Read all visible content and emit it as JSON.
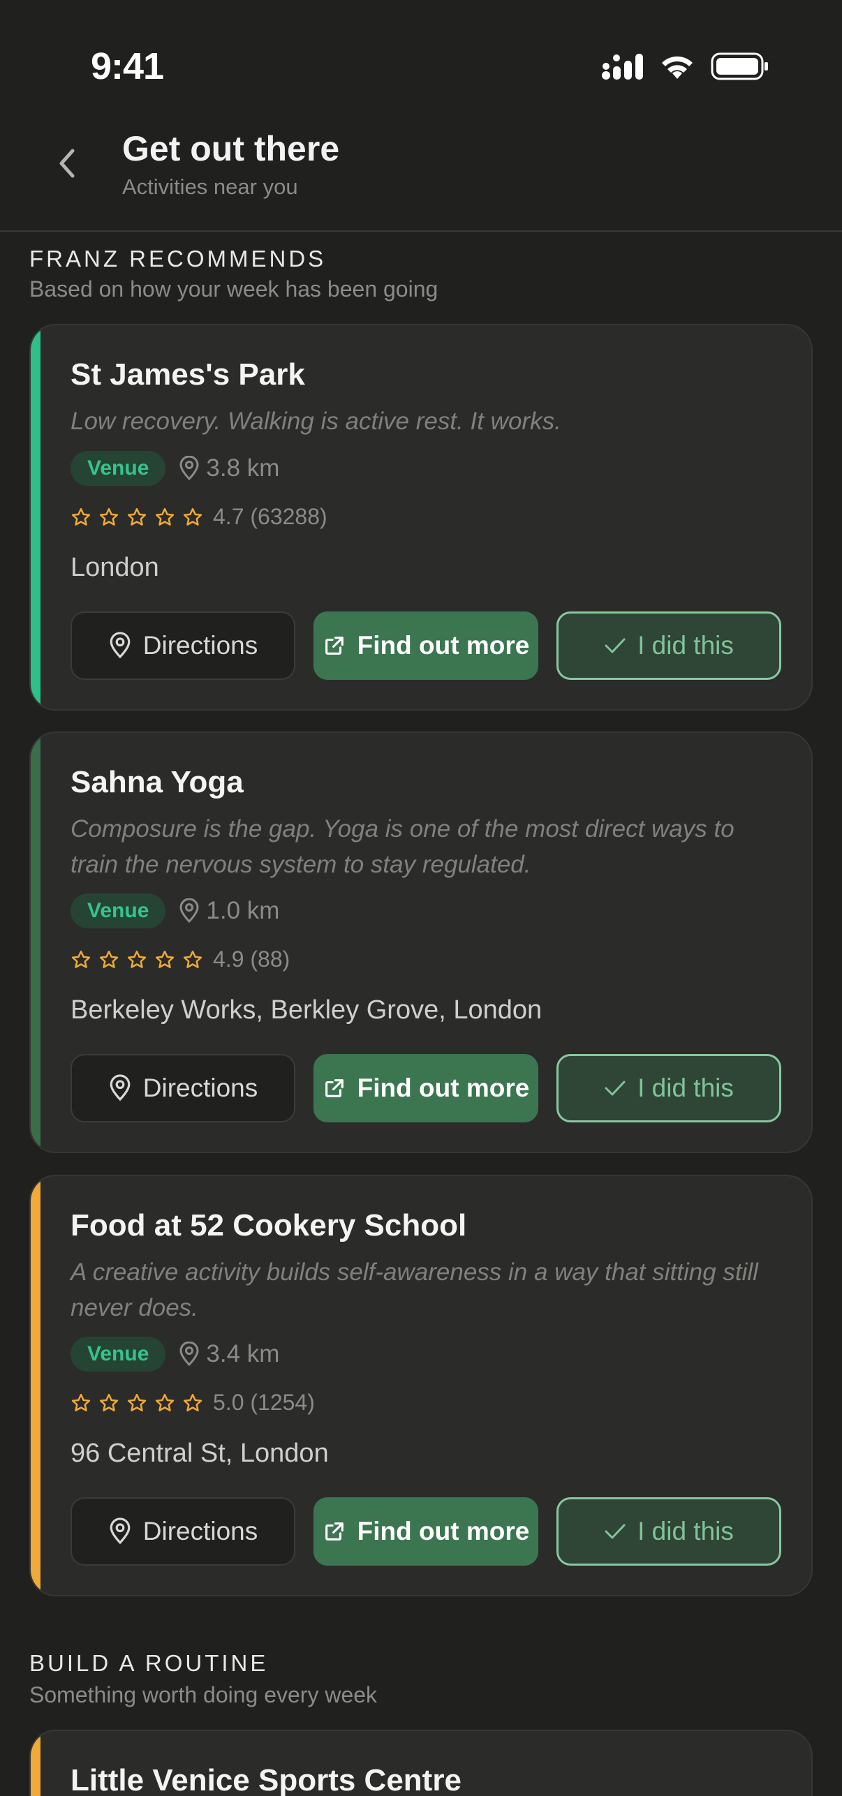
{
  "status": {
    "time": "9:41"
  },
  "header": {
    "title": "Get out there",
    "subtitle": "Activities near you"
  },
  "sections": [
    {
      "label": "FRANZ RECOMMENDS",
      "subtitle": "Based on how your week has been going",
      "cards": [
        {
          "title": "St James's Park",
          "description": "Low recovery. Walking is active rest. It works.",
          "badge": "Venue",
          "distance": "3.8 km",
          "rating": "4.7 (63288)",
          "address": "London",
          "accent": "#2fbf88",
          "buttons": {
            "directions": "Directions",
            "find_out": "Find out more",
            "did": "I did this"
          }
        },
        {
          "title": "Sahna Yoga",
          "description": "Composure is the gap. Yoga is one of the most direct ways to train the nervous system to stay regulated.",
          "badge": "Venue",
          "distance": "1.0 km",
          "rating": "4.9 (88)",
          "address": "Berkeley Works, Berkley Grove, London",
          "accent": "#3a6e4b",
          "buttons": {
            "directions": "Directions",
            "find_out": "Find out more",
            "did": "I did this"
          }
        },
        {
          "title": "Food at 52 Cookery School",
          "description": "A creative activity builds self-awareness in a way that sitting still never does.",
          "badge": "Venue",
          "distance": "3.4 km",
          "rating": "5.0 (1254)",
          "address": "96 Central St, London",
          "accent": "#f0aa3a",
          "buttons": {
            "directions": "Directions",
            "find_out": "Find out more",
            "did": "I did this"
          }
        }
      ]
    },
    {
      "label": "BUILD A ROUTINE",
      "subtitle": "Something worth doing every week",
      "cards": [
        {
          "title": "Little Venice Sports Centre",
          "accent": "#f0aa3a"
        }
      ]
    }
  ],
  "colors": {
    "background": "#20211f",
    "card": "#2b2c29",
    "venue_badge_text": "#35c48b",
    "star": "#f0aa3a",
    "primary_button": "#3b7650",
    "did_button_border": "#89c79f"
  }
}
